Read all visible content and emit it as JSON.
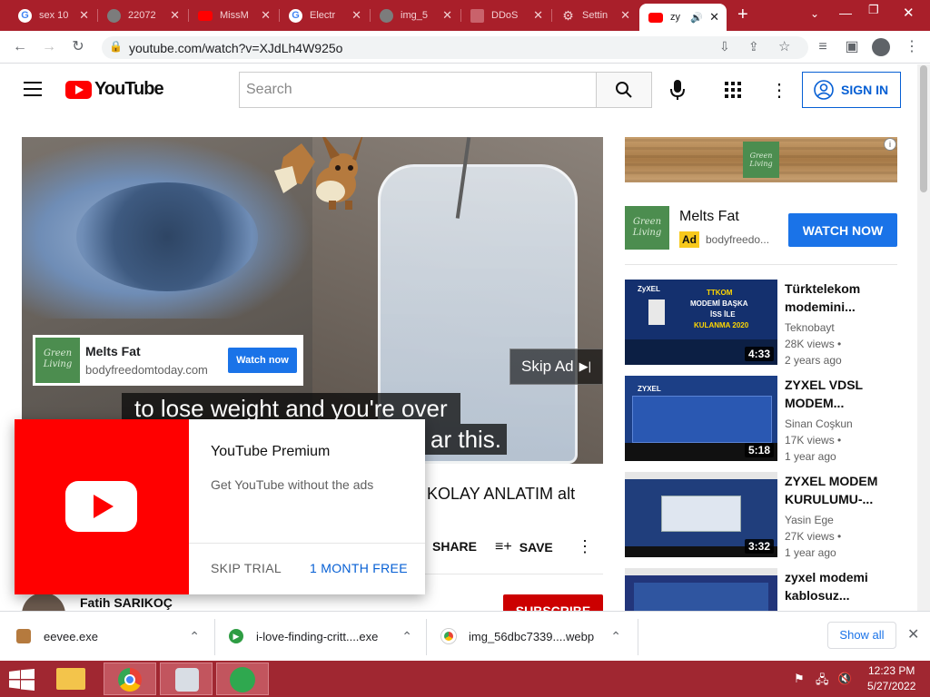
{
  "tabs": [
    {
      "title": "sex 10",
      "fav": "google-icon"
    },
    {
      "title": "22072",
      "fav": "globe-icon"
    },
    {
      "title": "MissM",
      "fav": "youtube-icon"
    },
    {
      "title": "Electr",
      "fav": "google-icon"
    },
    {
      "title": "img_5",
      "fav": "globe-icon"
    },
    {
      "title": "DDoS",
      "fav": "page-icon"
    },
    {
      "title": "Settin",
      "fav": "gear-icon"
    },
    {
      "title": "zy",
      "fav": "youtube-icon",
      "active": true
    }
  ],
  "address": "youtube.com/watch?v=XJdLh4W925o",
  "yt": {
    "logo": "YouTube",
    "search_placeholder": "Search",
    "signin": "SIGN IN"
  },
  "video": {
    "caption1": "to lose weight and you're over",
    "caption2": "ar this.",
    "ad_title": "Melts Fat",
    "ad_url": "bodyfreedomtoday.com",
    "ad_button": "Watch now",
    "skip_label": "Skip Ad",
    "logo_text": "Green Living"
  },
  "title_fragment": "KOLAY ANLATIM alt",
  "actions": {
    "share": "SHARE",
    "save": "SAVE",
    "more": "⋮"
  },
  "channel_name": "Fatih SARIKOÇ",
  "subscribe": "SUBSCRIBE",
  "premium": {
    "title": "YouTube Premium",
    "subtitle": "Get YouTube without the ads",
    "skip": "SKIP TRIAL",
    "free": "1 MONTH FREE"
  },
  "side_ad": {
    "title": "Melts Fat",
    "badge": "Ad",
    "url": "bodyfreedo...",
    "button": "WATCH NOW"
  },
  "side_videos": [
    {
      "title": "Türktelekom modemini...",
      "channel": "Teknobayt",
      "views": "28K views •",
      "age": "2 years ago",
      "duration": "4:33"
    },
    {
      "title": "ZYXEL VDSL MODEM...",
      "channel": "Sinan Coşkun",
      "views": "17K views •",
      "age": "1 year ago",
      "duration": "5:18"
    },
    {
      "title": "ZYXEL MODEM KURULUMU-...",
      "channel": "Yasin Ege",
      "views": "27K views •",
      "age": "1 year ago",
      "duration": "3:32"
    },
    {
      "title": "zyxel modemi kablosuz...",
      "channel": "",
      "views": "",
      "age": "",
      "duration": ""
    }
  ],
  "thumb1": {
    "line1": "TTKOM",
    "line2": "MODEMİ BAŞKA",
    "line3": "İSS İLE",
    "line4": "KULANMA 2020",
    "brand": "ZyXEL"
  },
  "thumb2": {
    "brand": "ZYXEL"
  },
  "downloads": [
    {
      "name": "eevee.exe"
    },
    {
      "name": "i-love-finding-critt....exe"
    },
    {
      "name": "img_56dbc7339....webp"
    }
  ],
  "show_all": "Show all",
  "clock": {
    "time": "12:23 PM",
    "date": "5/27/2022"
  }
}
